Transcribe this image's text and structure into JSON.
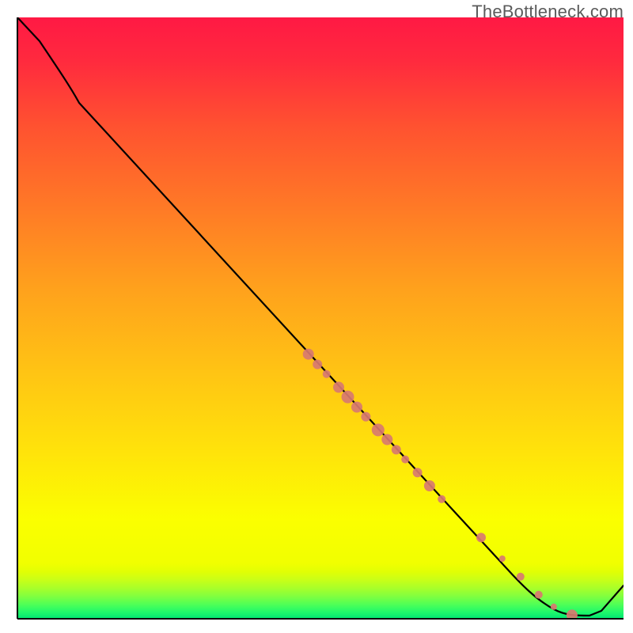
{
  "watermark": "TheBottleneck.com",
  "colors": {
    "dot": "#d87a70",
    "curve": "#000000",
    "grad_top": "#ff1944",
    "grad_mid": "#ffe40a",
    "grad_bottom": "#00e574"
  },
  "chart_data": {
    "type": "line",
    "title": "",
    "xlabel": "",
    "ylabel": "",
    "xlim": [
      0,
      100
    ],
    "ylim": [
      0,
      100
    ],
    "note": "Axes are unlabeled in the source image; x and y are normalized 0–100 across the plot box. The background gradient is vertical red→yellow→green with the green band compressed into roughly the bottom 9% of the plot height.",
    "series": [
      {
        "name": "bottleneck-curve",
        "x": [
          0,
          3.5,
          10,
          48,
          72,
          81,
          88,
          92,
          94.5,
          96,
          100
        ],
        "y": [
          100,
          96,
          86,
          44,
          18.5,
          8.5,
          2,
          0.5,
          0.5,
          1.3,
          5.5
        ]
      }
    ],
    "scatter": {
      "name": "marked-points",
      "comment": "Salmon dots clustered on the line between roughly x≈48..92; radii vary ~4–8px.",
      "points": [
        {
          "x": 48.0,
          "y": 44.0,
          "r": 7
        },
        {
          "x": 49.5,
          "y": 42.3,
          "r": 6
        },
        {
          "x": 51.0,
          "y": 40.7,
          "r": 5
        },
        {
          "x": 53.0,
          "y": 38.5,
          "r": 7
        },
        {
          "x": 54.5,
          "y": 36.9,
          "r": 8
        },
        {
          "x": 56.0,
          "y": 35.2,
          "r": 7
        },
        {
          "x": 57.5,
          "y": 33.6,
          "r": 6
        },
        {
          "x": 59.5,
          "y": 31.4,
          "r": 8
        },
        {
          "x": 61.0,
          "y": 29.8,
          "r": 7
        },
        {
          "x": 62.5,
          "y": 28.1,
          "r": 6
        },
        {
          "x": 64.0,
          "y": 26.5,
          "r": 5
        },
        {
          "x": 66.0,
          "y": 24.3,
          "r": 6
        },
        {
          "x": 68.0,
          "y": 22.1,
          "r": 7
        },
        {
          "x": 70.0,
          "y": 19.9,
          "r": 5
        },
        {
          "x": 76.5,
          "y": 13.5,
          "r": 6
        },
        {
          "x": 80.0,
          "y": 10.0,
          "r": 4
        },
        {
          "x": 83.0,
          "y": 7.0,
          "r": 5
        },
        {
          "x": 86.0,
          "y": 4.0,
          "r": 5
        },
        {
          "x": 88.5,
          "y": 2.0,
          "r": 4
        },
        {
          "x": 91.5,
          "y": 0.6,
          "r": 7
        }
      ]
    },
    "background_gradient": {
      "orientation": "vertical",
      "stops_y_fraction_from_top": [
        {
          "y": 0.0,
          "color": "#ff1944"
        },
        {
          "y": 0.5,
          "color": "#ffa21c"
        },
        {
          "y": 0.91,
          "color": "#f1ff00"
        },
        {
          "y": 1.0,
          "color": "#00e574"
        }
      ]
    }
  }
}
